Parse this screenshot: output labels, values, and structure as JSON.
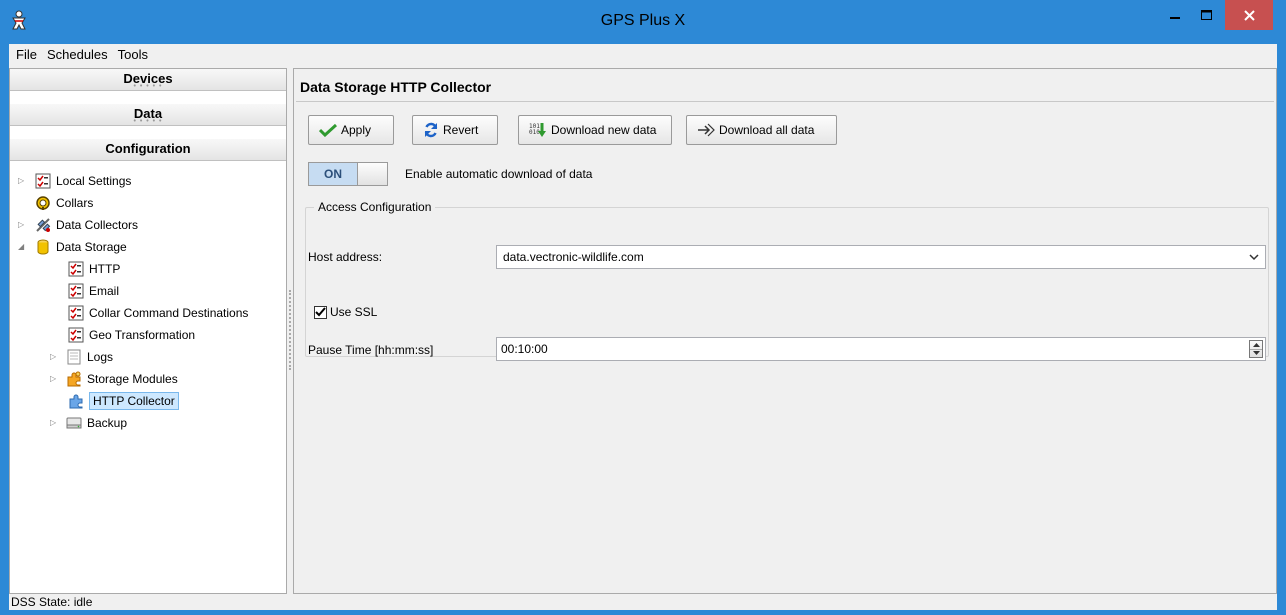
{
  "window": {
    "title": "GPS Plus X",
    "controls": {
      "minimize": "minimize",
      "maximize": "maximize",
      "close": "close"
    }
  },
  "menu": [
    {
      "label": "File"
    },
    {
      "label": "Schedules"
    },
    {
      "label": "Tools"
    }
  ],
  "left": {
    "sections": [
      {
        "label": "Devices"
      },
      {
        "label": "Data"
      },
      {
        "label": "Configuration"
      }
    ],
    "tree": [
      {
        "label": "Local Settings",
        "icon": "checklist-icon"
      },
      {
        "label": "Collars",
        "icon": "collar-icon"
      },
      {
        "label": "Data Collectors",
        "icon": "satellite-icon"
      },
      {
        "label": "Data Storage",
        "icon": "database-icon"
      },
      {
        "label": "HTTP",
        "icon": "checklist-icon"
      },
      {
        "label": "Email",
        "icon": "checklist-icon"
      },
      {
        "label": "Collar Command Destinations",
        "icon": "checklist-icon"
      },
      {
        "label": "Geo Transformation",
        "icon": "checklist-icon"
      },
      {
        "label": "Logs",
        "icon": "document-icon"
      },
      {
        "label": "Storage Modules",
        "icon": "puzzle-icon"
      },
      {
        "label": "HTTP Collector",
        "icon": "puzzle-icon",
        "selected": true
      },
      {
        "label": "Backup",
        "icon": "drive-icon"
      }
    ]
  },
  "panel": {
    "title": "Data Storage HTTP Collector",
    "buttons": {
      "apply": "Apply",
      "revert": "Revert",
      "download_new": "Download new data",
      "download_all": "Download all data"
    },
    "toggle": {
      "state": "ON",
      "label": "Enable automatic download of data"
    },
    "group": {
      "legend": "Access Configuration",
      "host_label": "Host address:",
      "host_value": "data.vectronic-wildlife.com",
      "ssl_label": "Use SSL",
      "ssl_checked": true,
      "pause_label": "Pause Time [hh:mm:ss]",
      "pause_value": "00:10:00"
    }
  },
  "status": {
    "text": "DSS State: idle"
  },
  "colors": {
    "titlebar": "#2d89d6",
    "close": "#c75050",
    "selection": "#cde8ff",
    "toggle_on": "#c6dcf2"
  }
}
